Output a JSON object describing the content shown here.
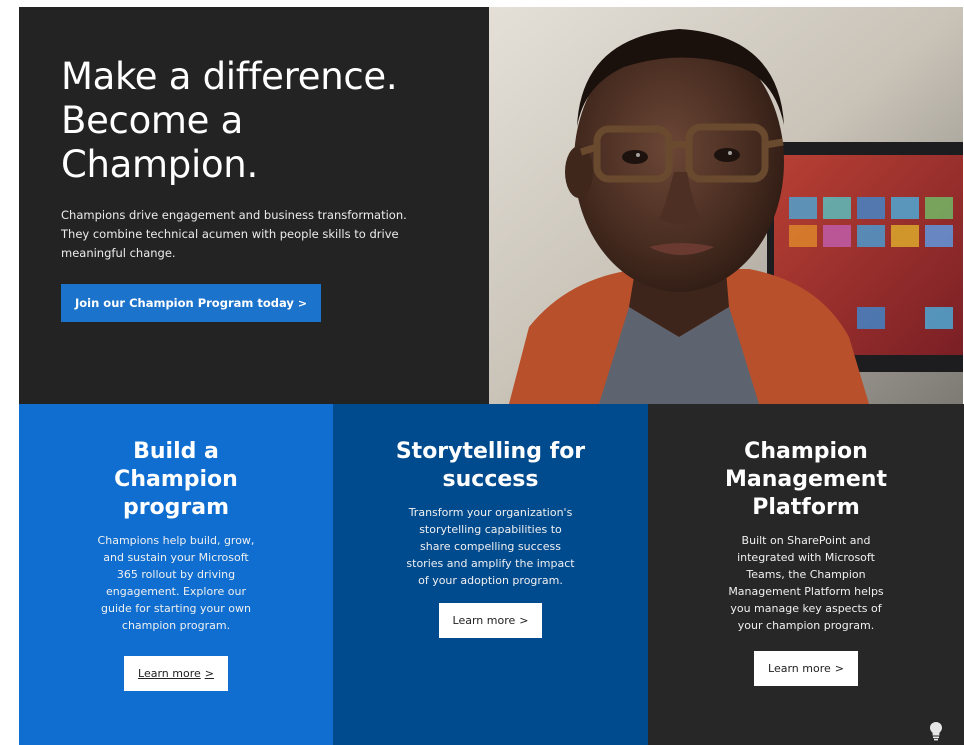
{
  "hero": {
    "title_lines": [
      "Make a difference.",
      "Become a",
      "Champion."
    ],
    "description": "Champions drive engagement and business transformation. They combine technical acumen with people skills to drive meaningful change.",
    "cta_label": "Join our Champion Program today",
    "cta_color": "#1c73cc",
    "background_color": "#232323"
  },
  "tiles": [
    {
      "title_lines": [
        "Build a",
        "Champion",
        "program"
      ],
      "description_lines": [
        "Champions help build, grow,",
        "and sustain your Microsoft",
        "365 rollout by driving",
        "engagement. Explore our",
        "guide for starting your own",
        "champion program."
      ],
      "button_label": "Learn more",
      "background_color": "#0f6ed0"
    },
    {
      "title_lines": [
        "Storytelling for",
        "success"
      ],
      "description_lines": [
        "Transform your organization's",
        "storytelling capabilities to",
        "share compelling success",
        "stories and amplify the impact",
        "of your adoption program."
      ],
      "button_label": "Learn more",
      "background_color": "#004a8e"
    },
    {
      "title_lines": [
        "Champion",
        "Management",
        "Platform"
      ],
      "description_lines": [
        "Built on SharePoint and",
        "integrated with Microsoft",
        "Teams, the Champion",
        "Management Platform helps",
        "you manage key aspects of",
        "your champion program."
      ],
      "button_label": "Learn more",
      "background_color": "#272727"
    }
  ],
  "icons": {
    "cta_chevron": "chevron-right-icon",
    "feedback": "lightbulb-icon"
  }
}
